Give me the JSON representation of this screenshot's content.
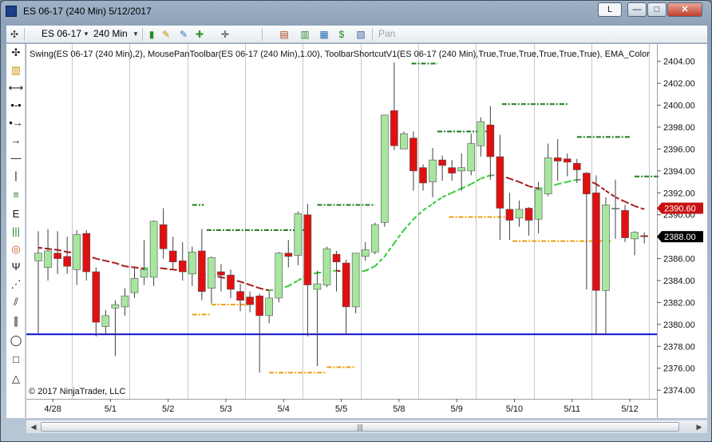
{
  "window": {
    "title": "ES 06-17 (240 Min)  5/12/2017",
    "btn_l": "L",
    "btn_min": "—",
    "btn_max": "□",
    "btn_close": "✕"
  },
  "toolbar": {
    "instrument": "ES 06-17",
    "interval": "240 Min",
    "pan": "Pan"
  },
  "chart_data": {
    "type": "candlestick",
    "indicator_label": "Swing(ES 06-17 (240 Min),2), MousePanToolbar(ES 06-17 (240 Min),1.00), ToolbarShortcutV1(ES 06-17 (240 Min),True,True,True,True,True,True), EMA_Color",
    "copyright": "© 2017 NinjaTrader, LLC",
    "ylim": [
      2373.5,
      2405
    ],
    "yticks": [
      2374,
      2376,
      2378,
      2380,
      2382,
      2384,
      2386,
      2388,
      2390,
      2392,
      2394,
      2396,
      2398,
      2400,
      2402,
      2404
    ],
    "ytick_labels": [
      "2374.00",
      "2376.00",
      "2378.00",
      "2380.00",
      "2382.00",
      "2384.00",
      "2386.00",
      "2388.00",
      "2390.00",
      "2392.00",
      "2394.00",
      "2396.00",
      "2398.00",
      "2400.00",
      "2402.00",
      "2404.00"
    ],
    "xlabels": [
      {
        "label": "4/28",
        "bar": 1.5
      },
      {
        "label": "5/1",
        "bar": 7.5
      },
      {
        "label": "5/2",
        "bar": 13.5
      },
      {
        "label": "5/3",
        "bar": 19.5
      },
      {
        "label": "5/4",
        "bar": 25.5
      },
      {
        "label": "5/5",
        "bar": 31.5
      },
      {
        "label": "5/8",
        "bar": 37.5
      },
      {
        "label": "5/9",
        "bar": 43.5
      },
      {
        "label": "5/10",
        "bar": 49.5
      },
      {
        "label": "5/11",
        "bar": 55.5
      },
      {
        "label": "5/12",
        "bar": 61.5
      }
    ],
    "session_breaks": [
      4,
      10,
      16,
      22,
      28,
      34,
      40,
      46,
      52,
      58,
      64
    ],
    "candles": [
      {
        "o": 2385.8,
        "h": 2388.5,
        "l": 2379.2,
        "c": 2386.5
      },
      {
        "o": 2385.2,
        "h": 2388.7,
        "l": 2384.0,
        "c": 2386.7
      },
      {
        "o": 2386.5,
        "h": 2388.5,
        "l": 2384.6,
        "c": 2386.0
      },
      {
        "o": 2386.2,
        "h": 2388.0,
        "l": 2384.6,
        "c": 2385.3
      },
      {
        "o": 2385.0,
        "h": 2388.6,
        "l": 2383.6,
        "c": 2388.2
      },
      {
        "o": 2388.3,
        "h": 2388.6,
        "l": 2384.0,
        "c": 2384.8
      },
      {
        "o": 2384.8,
        "h": 2385.2,
        "l": 2378.9,
        "c": 2380.2
      },
      {
        "o": 2379.8,
        "h": 2381.3,
        "l": 2379.1,
        "c": 2380.8
      },
      {
        "o": 2381.5,
        "h": 2382.2,
        "l": 2377.1,
        "c": 2381.8
      },
      {
        "o": 2381.6,
        "h": 2383.3,
        "l": 2380.8,
        "c": 2382.6
      },
      {
        "o": 2382.9,
        "h": 2385.2,
        "l": 2382.4,
        "c": 2384.2
      },
      {
        "o": 2384.3,
        "h": 2387.7,
        "l": 2383.6,
        "c": 2385.0
      },
      {
        "o": 2384.3,
        "h": 2389.5,
        "l": 2383.5,
        "c": 2389.4
      },
      {
        "o": 2389.1,
        "h": 2390.6,
        "l": 2386.0,
        "c": 2386.9
      },
      {
        "o": 2386.7,
        "h": 2388.0,
        "l": 2385.1,
        "c": 2385.7
      },
      {
        "o": 2385.8,
        "h": 2387.5,
        "l": 2384.0,
        "c": 2384.8
      },
      {
        "o": 2384.6,
        "h": 2387.1,
        "l": 2383.5,
        "c": 2386.6
      },
      {
        "o": 2386.7,
        "h": 2388.7,
        "l": 2382.2,
        "c": 2383.0
      },
      {
        "o": 2383.3,
        "h": 2386.2,
        "l": 2381.9,
        "c": 2386.1
      },
      {
        "o": 2384.8,
        "h": 2385.5,
        "l": 2383.0,
        "c": 2384.5
      },
      {
        "o": 2384.5,
        "h": 2385.0,
        "l": 2382.4,
        "c": 2383.2
      },
      {
        "o": 2383.0,
        "h": 2383.7,
        "l": 2381.2,
        "c": 2382.2
      },
      {
        "o": 2382.5,
        "h": 2383.0,
        "l": 2381.1,
        "c": 2381.8
      },
      {
        "o": 2382.6,
        "h": 2382.8,
        "l": 2375.6,
        "c": 2380.8
      },
      {
        "o": 2380.8,
        "h": 2383.0,
        "l": 2380.1,
        "c": 2382.4
      },
      {
        "o": 2382.4,
        "h": 2386.6,
        "l": 2382.0,
        "c": 2386.5
      },
      {
        "o": 2386.5,
        "h": 2387.7,
        "l": 2385.2,
        "c": 2386.2
      },
      {
        "o": 2386.3,
        "h": 2390.3,
        "l": 2385.4,
        "c": 2390.1
      },
      {
        "o": 2390.0,
        "h": 2391.0,
        "l": 2378.9,
        "c": 2383.6
      },
      {
        "o": 2383.2,
        "h": 2384.9,
        "l": 2376.2,
        "c": 2383.7
      },
      {
        "o": 2383.6,
        "h": 2387.1,
        "l": 2383.4,
        "c": 2386.9
      },
      {
        "o": 2386.4,
        "h": 2386.7,
        "l": 2383.0,
        "c": 2385.7
      },
      {
        "o": 2385.6,
        "h": 2385.9,
        "l": 2379.1,
        "c": 2381.6
      },
      {
        "o": 2381.6,
        "h": 2385.2,
        "l": 2381.0,
        "c": 2386.5
      },
      {
        "o": 2386.2,
        "h": 2387.5,
        "l": 2385.8,
        "c": 2386.8
      },
      {
        "o": 2386.6,
        "h": 2389.3,
        "l": 2386.4,
        "c": 2389.1
      },
      {
        "o": 2389.3,
        "h": 2391.2,
        "l": 2388.9,
        "c": 2399.1
      },
      {
        "o": 2399.5,
        "h": 2403.9,
        "l": 2395.9,
        "c": 2396.3
      },
      {
        "o": 2396.0,
        "h": 2397.6,
        "l": 2396.0,
        "c": 2397.4
      },
      {
        "o": 2397.0,
        "h": 2397.6,
        "l": 2392.2,
        "c": 2394.0
      },
      {
        "o": 2394.3,
        "h": 2394.6,
        "l": 2392.2,
        "c": 2392.9
      },
      {
        "o": 2393.0,
        "h": 2396.1,
        "l": 2391.6,
        "c": 2395.0
      },
      {
        "o": 2395.0,
        "h": 2395.4,
        "l": 2393.1,
        "c": 2394.5
      },
      {
        "o": 2394.3,
        "h": 2395.0,
        "l": 2393.1,
        "c": 2393.8
      },
      {
        "o": 2394.0,
        "h": 2395.6,
        "l": 2392.2,
        "c": 2394.3
      },
      {
        "o": 2394.0,
        "h": 2397.4,
        "l": 2393.6,
        "c": 2396.5
      },
      {
        "o": 2396.3,
        "h": 2398.9,
        "l": 2395.3,
        "c": 2398.5
      },
      {
        "o": 2398.2,
        "h": 2399.9,
        "l": 2393.2,
        "c": 2395.3
      },
      {
        "o": 2395.3,
        "h": 2397.3,
        "l": 2387.7,
        "c": 2390.6
      },
      {
        "o": 2390.5,
        "h": 2392.0,
        "l": 2387.7,
        "c": 2389.5
      },
      {
        "o": 2389.7,
        "h": 2391.3,
        "l": 2388.9,
        "c": 2390.5
      },
      {
        "o": 2390.6,
        "h": 2390.7,
        "l": 2388.1,
        "c": 2389.5
      },
      {
        "o": 2389.6,
        "h": 2393.0,
        "l": 2388.3,
        "c": 2392.3
      },
      {
        "o": 2391.9,
        "h": 2396.5,
        "l": 2391.7,
        "c": 2395.2
      },
      {
        "o": 2395.2,
        "h": 2396.9,
        "l": 2393.1,
        "c": 2394.9
      },
      {
        "o": 2395.1,
        "h": 2395.6,
        "l": 2393.5,
        "c": 2394.8
      },
      {
        "o": 2394.7,
        "h": 2395.1,
        "l": 2392.9,
        "c": 2394.1
      },
      {
        "o": 2393.8,
        "h": 2393.9,
        "l": 2383.2,
        "c": 2391.9
      },
      {
        "o": 2392.0,
        "h": 2393.6,
        "l": 2379.1,
        "c": 2383.1
      },
      {
        "o": 2383.1,
        "h": 2391.6,
        "l": 2379.1,
        "c": 2390.9
      },
      {
        "o": 2390.6,
        "h": 2393.2,
        "l": 2387.8,
        "c": 2390.6
      },
      {
        "o": 2390.4,
        "h": 2390.9,
        "l": 2387.5,
        "c": 2387.9
      },
      {
        "o": 2387.8,
        "h": 2388.5,
        "l": 2386.3,
        "c": 2388.4
      },
      {
        "o": 2388.1,
        "h": 2388.4,
        "l": 2387.4,
        "c": 2388.0
      }
    ],
    "ema": [
      2387.0,
      2386.9,
      2386.8,
      2386.6,
      2386.5,
      2386.3,
      2386.0,
      2385.8,
      2385.6,
      2385.3,
      2385.2,
      2385.1,
      2385.2,
      2385.1,
      2385.0,
      2384.9,
      2384.8,
      2384.6,
      2384.5,
      2384.3,
      2384.1,
      2383.9,
      2383.6,
      2383.3,
      2383.1,
      2383.2,
      2383.5,
      2384.0,
      2384.5,
      2384.7,
      2384.8,
      2384.9,
      2384.8,
      2384.7,
      2384.9,
      2385.3,
      2386.2,
      2387.4,
      2388.6,
      2389.6,
      2390.4,
      2391.0,
      2391.6,
      2392.0,
      2392.4,
      2392.8,
      2393.3,
      2393.6,
      2393.6,
      2393.3,
      2393.0,
      2392.6,
      2392.4,
      2392.5,
      2392.8,
      2393.0,
      2393.2,
      2393.2,
      2392.8,
      2392.2,
      2391.6,
      2391.2,
      2390.8,
      2390.5
    ],
    "swing_highs": [
      {
        "price": 2390.9,
        "from": 16,
        "to": 17.2
      },
      {
        "price": 2388.6,
        "from": 17.5,
        "to": 28
      },
      {
        "price": 2390.9,
        "from": 29,
        "to": 35
      },
      {
        "price": 2403.8,
        "from": 38.8,
        "to": 41.5
      },
      {
        "price": 2397.6,
        "from": 41.5,
        "to": 47.2
      },
      {
        "price": 2400.1,
        "from": 48.2,
        "to": 55
      },
      {
        "price": 2397.1,
        "from": 56,
        "to": 61.6
      },
      {
        "price": 2393.5,
        "from": 62,
        "to": 64.6
      }
    ],
    "swing_lows": [
      {
        "price": 2380.9,
        "from": 16,
        "to": 17.8
      },
      {
        "price": 2381.8,
        "from": 18,
        "to": 22
      },
      {
        "price": 2375.6,
        "from": 24,
        "to": 30
      },
      {
        "price": 2376.1,
        "from": 30,
        "to": 33
      },
      {
        "price": 2389.8,
        "from": 42.7,
        "to": 49.2
      },
      {
        "price": 2387.6,
        "from": 49.3,
        "to": 59.5
      }
    ],
    "hline_price": 2379.1,
    "last_price_label": "2390.60",
    "last_price_value": 2390.6,
    "current_price_label": "2388.00",
    "current_price_value": 2388.0,
    "colors": {
      "up": "#a8e6a0",
      "down": "#e01010",
      "wick": "#404040",
      "ema_up": "#33cc33",
      "ema_flat": "#8c8c8c",
      "ema_down": "#a51c1c",
      "swing_high": "#1b7a1b",
      "swing_low": "#f0a010",
      "hline": "#0c0ccc",
      "vgrid": "#c8c8c8",
      "last_label_bg": "#c81010",
      "current_label_bg": "#000000"
    }
  }
}
